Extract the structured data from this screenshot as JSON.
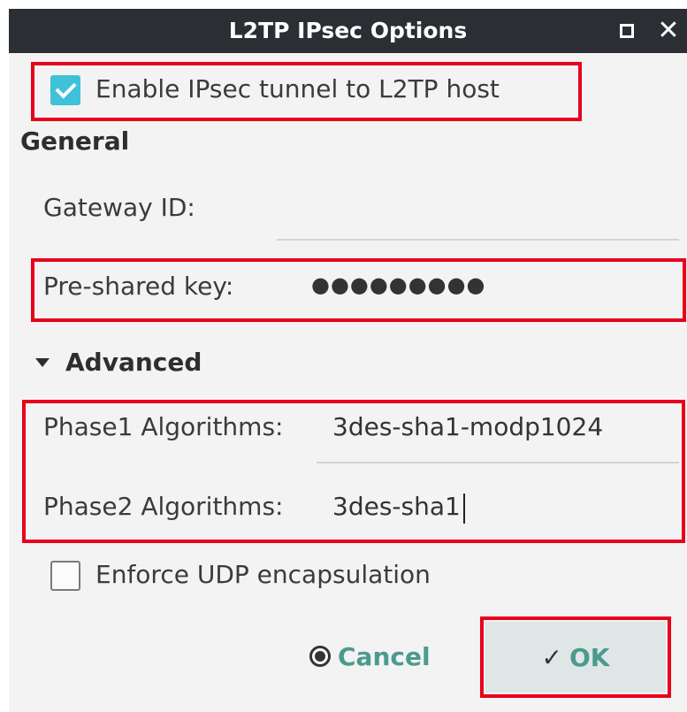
{
  "window": {
    "title": "L2TP IPsec Options",
    "close_glyph": "✕"
  },
  "enable_tunnel": {
    "label": "Enable IPsec tunnel to L2TP host",
    "checked": true
  },
  "general": {
    "heading": "General",
    "gateway_id": {
      "label": "Gateway ID:",
      "value": ""
    },
    "psk": {
      "label": "Pre-shared key:",
      "value": "●●●●●●●●●"
    }
  },
  "advanced": {
    "heading": "Advanced",
    "expanded": true,
    "phase1": {
      "label": "Phase1 Algorithms:",
      "value": "3des-sha1-modp1024"
    },
    "phase2": {
      "label": "Phase2 Algorithms:",
      "value": "3des-sha1"
    }
  },
  "enforce_udp": {
    "label": "Enforce UDP encapsulation",
    "checked": false
  },
  "buttons": {
    "cancel_label": "Cancel",
    "ok_label": "OK",
    "ok_glyph": "✓"
  },
  "colors": {
    "titlebar": "#2b2e33",
    "accent": "#4b9a8f",
    "checkbox": "#3fc1da",
    "highlight": "#e8001c"
  },
  "icons": [
    "maximize-icon",
    "close-icon",
    "checkmark-icon",
    "expander-triangle-icon",
    "cancel-icon",
    "ok-check-icon"
  ]
}
